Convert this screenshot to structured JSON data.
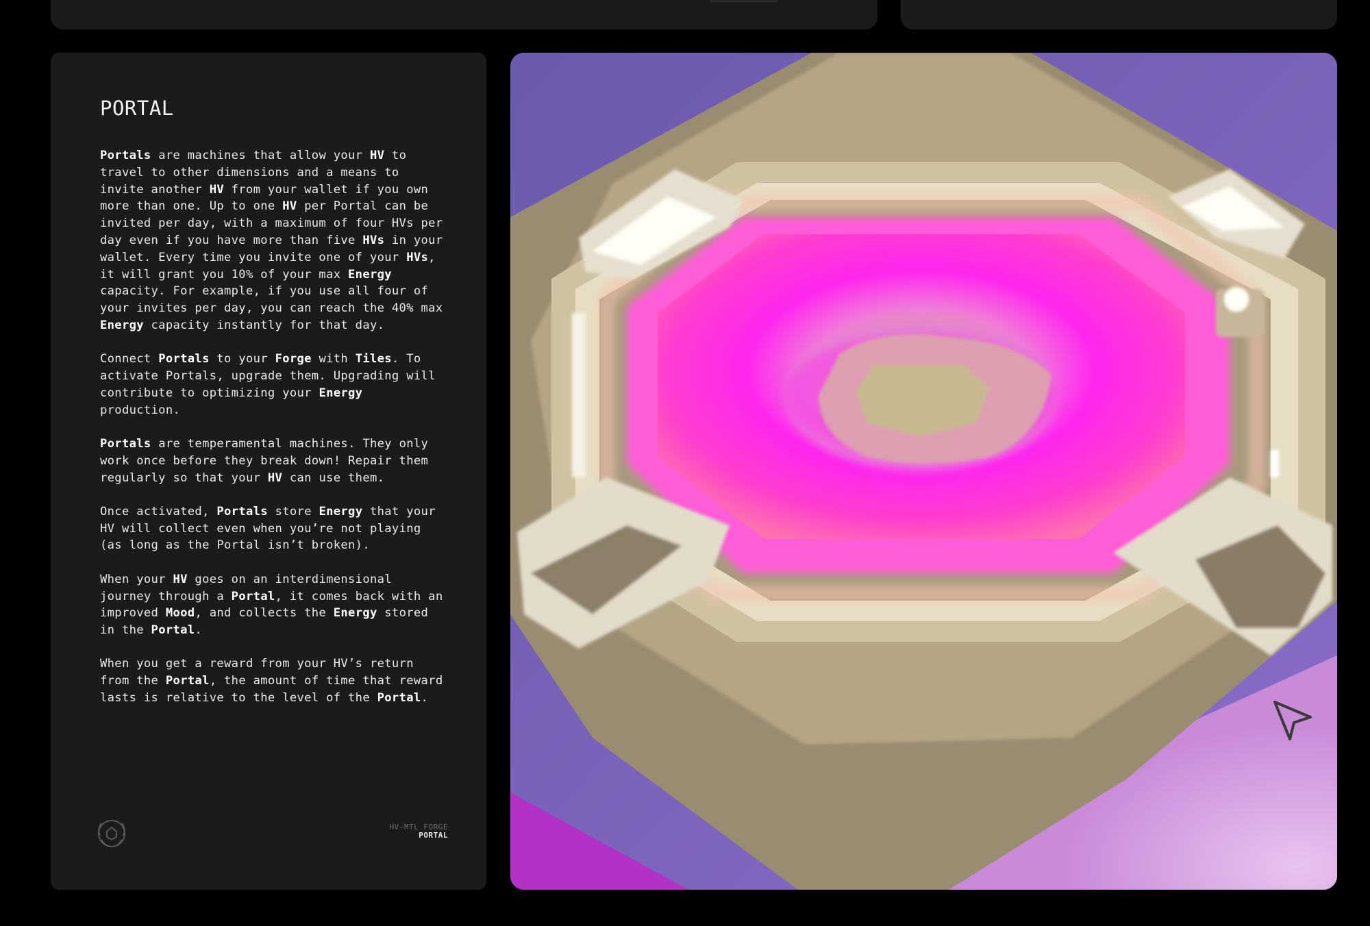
{
  "info_panel": {
    "title": "PORTAL",
    "paragraphs": [
      [
        {
          "t": "Portals",
          "b": true
        },
        {
          "t": " are machines that allow your "
        },
        {
          "t": "HV",
          "b": true
        },
        {
          "t": " to travel to other dimensions and a means to invite another "
        },
        {
          "t": "HV",
          "b": true
        },
        {
          "t": " from your wallet if you own more than one. Up to one "
        },
        {
          "t": "HV",
          "b": true
        },
        {
          "t": " per Portal can be invited per day, with a maximum of four HVs per day even if you have more than five "
        },
        {
          "t": "HVs",
          "b": true
        },
        {
          "t": " in your wallet. Every time you invite one of your "
        },
        {
          "t": "HVs",
          "b": true
        },
        {
          "t": ", it will grant you 10% of your max "
        },
        {
          "t": "Energy",
          "b": true
        },
        {
          "t": " capacity. For example, if you use all four of your invites per day, you can reach the 40% max "
        },
        {
          "t": "Energy",
          "b": true
        },
        {
          "t": " capacity instantly for that day."
        }
      ],
      [
        {
          "t": "Connect "
        },
        {
          "t": "Portals",
          "b": true
        },
        {
          "t": " to your "
        },
        {
          "t": "Forge",
          "b": true
        },
        {
          "t": " with "
        },
        {
          "t": "Tiles",
          "b": true
        },
        {
          "t": ". To activate Portals, upgrade them. Upgrading will contribute to optimizing your "
        },
        {
          "t": "Energy",
          "b": true
        },
        {
          "t": " production."
        }
      ],
      [
        {
          "t": "Portals",
          "b": true
        },
        {
          "t": " are temperamental machines. They only work once before they break down! Repair them regularly so that your "
        },
        {
          "t": "HV",
          "b": true
        },
        {
          "t": " can use them."
        }
      ],
      [
        {
          "t": "Once activated, "
        },
        {
          "t": "Portals",
          "b": true
        },
        {
          "t": " store "
        },
        {
          "t": "Energy",
          "b": true
        },
        {
          "t": " that your HV will collect even when you’re not playing (as long as the Portal isn’t broken)."
        }
      ],
      [
        {
          "t": "When your "
        },
        {
          "t": "HV",
          "b": true
        },
        {
          "t": " goes on an interdimensional journey through a "
        },
        {
          "t": "Portal",
          "b": true
        },
        {
          "t": ", it comes back with an improved "
        },
        {
          "t": "Mood",
          "b": true
        },
        {
          "t": ", and collects the "
        },
        {
          "t": "Energy",
          "b": true
        },
        {
          "t": " stored in the "
        },
        {
          "t": "Portal",
          "b": true
        },
        {
          "t": "."
        }
      ],
      [
        {
          "t": "When you get a reward from your HV’s return from the "
        },
        {
          "t": "Portal",
          "b": true
        },
        {
          "t": ", the amount of time that reward lasts is relative to the level of the "
        },
        {
          "t": "Portal",
          "b": true
        },
        {
          "t": "."
        }
      ]
    ],
    "footer": {
      "logo_icon": "laurel-crest-icon",
      "subtitle": "HV-MTL FORGE",
      "label": "PORTAL"
    }
  },
  "media": {
    "subject": "portal-render",
    "cursor_icon": "pointer-arrow-icon"
  },
  "colors": {
    "page_bg": "#000000",
    "card_bg": "#1b1b1b",
    "text": "#e9e9e9",
    "text_bold": "#ffffff",
    "portal_glow": "#ff2ef0",
    "sky": "#7a63be"
  }
}
